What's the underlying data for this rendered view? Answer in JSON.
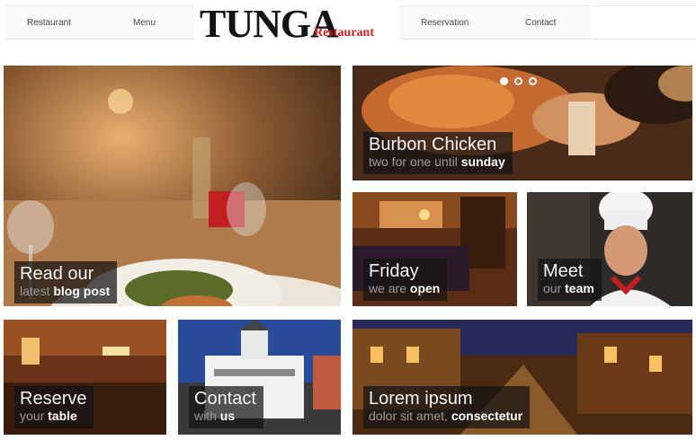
{
  "nav": {
    "left": [
      "Restaurant",
      "Menu"
    ],
    "right": [
      "Reservation",
      "Contact"
    ]
  },
  "logo": {
    "main": "TUNGA",
    "sub": "Restaurant"
  },
  "tiles": {
    "blog": {
      "line1": "Read our",
      "line2_normal": "latest ",
      "line2_bold": "blog post"
    },
    "chicken": {
      "line1": "Burbon Chicken",
      "line2_normal": "two for one until ",
      "line2_bold": "sunday"
    },
    "friday": {
      "line1": "Friday",
      "line2_normal": "we are ",
      "line2_bold": "open"
    },
    "team": {
      "line1": "Meet",
      "line2_normal": "our ",
      "line2_bold": "team"
    },
    "reserve": {
      "line1": "Reserve",
      "line2_normal": "your ",
      "line2_bold": "table"
    },
    "contact": {
      "line1": "Contact",
      "line2_normal": "with ",
      "line2_bold": "us"
    },
    "lorem": {
      "line1": "Lorem ipsum",
      "line2_normal": "dolor sit amet, ",
      "line2_bold": "consectetur"
    }
  },
  "slider": {
    "dots": 3,
    "active_index": 0
  },
  "colors": {
    "logo_accent": "#d02020",
    "caption_bg": "#141414"
  }
}
